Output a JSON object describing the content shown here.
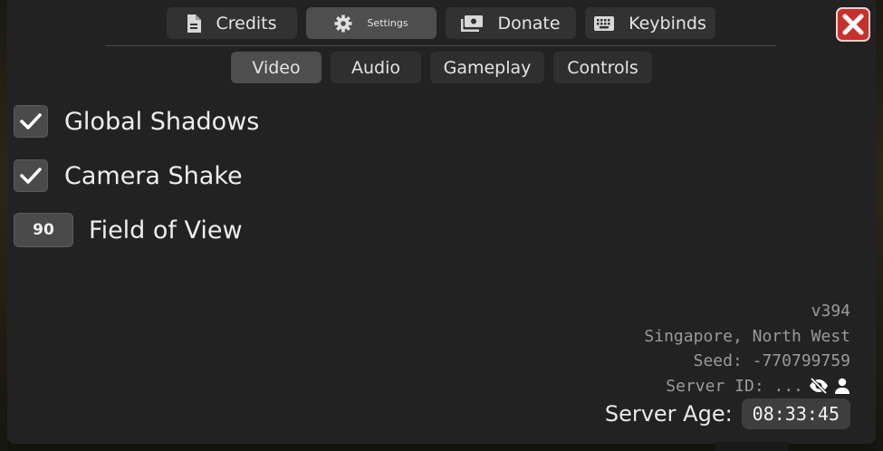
{
  "top_tabs": {
    "credits": "Credits",
    "settings": "Settings",
    "donate": "Donate",
    "keybinds": "Keybinds"
  },
  "sub_tabs": {
    "video": "Video",
    "audio": "Audio",
    "gameplay": "Gameplay",
    "controls": "Controls"
  },
  "settings": {
    "global_shadows": {
      "label": "Global Shadows",
      "checked": true
    },
    "camera_shake": {
      "label": "Camera Shake",
      "checked": true
    },
    "field_of_view": {
      "label": "Field of View",
      "value": "90"
    }
  },
  "info": {
    "version": "v394",
    "region": "Singapore, North West",
    "seed": "Seed: -770799759",
    "server_id": "Server ID: ..."
  },
  "server_age": {
    "label": "Server Age:",
    "value": "08:33:45"
  },
  "icons": {
    "credits": "document-icon",
    "settings": "gear-icon",
    "donate": "money-icon",
    "keybinds": "keyboard-icon",
    "close": "close-icon",
    "hide": "eye-off-icon",
    "user": "person-icon"
  },
  "colors": {
    "panel": "#222222",
    "tab": "#323232",
    "tab_active": "#4e4e4e",
    "close": "#c8302c"
  }
}
